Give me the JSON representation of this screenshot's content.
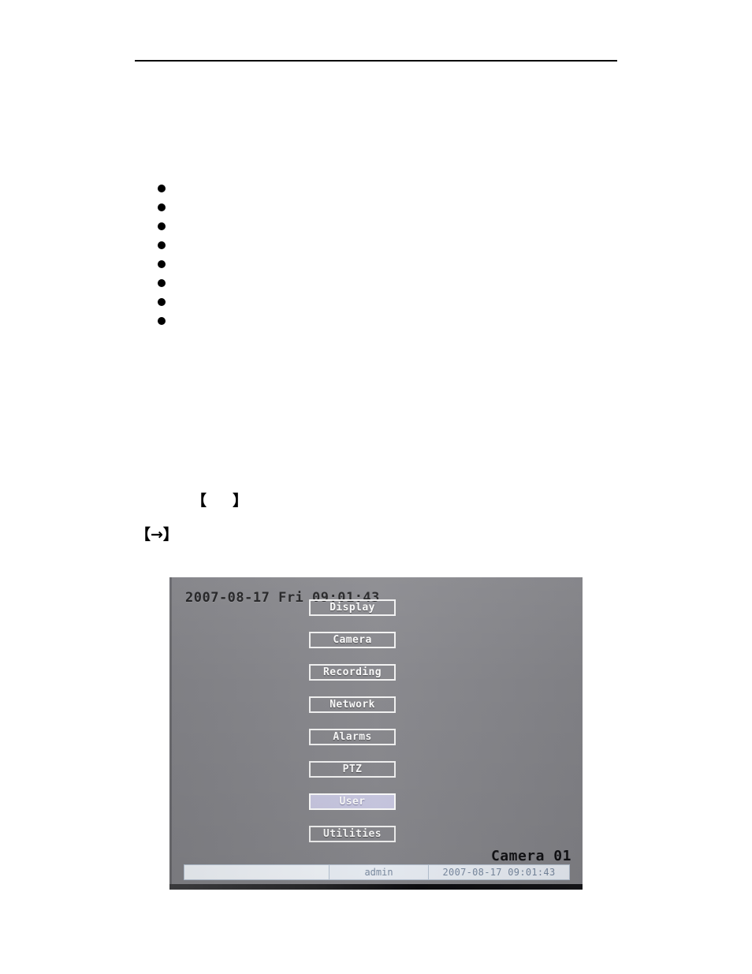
{
  "document": {
    "header_rule": true,
    "bullets": [
      {
        "text": ""
      },
      {
        "text": ""
      },
      {
        "text": ""
      },
      {
        "text": ""
      },
      {
        "text": ""
      },
      {
        "text": ""
      },
      {
        "text": ""
      },
      {
        "text": ""
      }
    ],
    "notes": [
      {
        "text": "【     】"
      },
      {
        "text": "【→】"
      }
    ]
  },
  "figure": {
    "osd": {
      "datetime": "2007-08-17 Fri 09:01:43",
      "camera_title": "Camera 01"
    },
    "menu": {
      "items": [
        {
          "label": "Display",
          "selected": false
        },
        {
          "label": "Camera",
          "selected": false
        },
        {
          "label": "Recording",
          "selected": false
        },
        {
          "label": "Network",
          "selected": false
        },
        {
          "label": "Alarms",
          "selected": false
        },
        {
          "label": "PTZ",
          "selected": false
        },
        {
          "label": "User",
          "selected": true
        },
        {
          "label": "Utilities",
          "selected": false
        }
      ]
    },
    "status_bar": {
      "message": "",
      "user": "admin",
      "datetime": "2007-08-17 09:01:43"
    },
    "colors": {
      "screen_background": "#86868b",
      "button_border": "#f2f2f2",
      "button_text": "#fbfbfb",
      "selected_fill": "#c9c8e2",
      "status_bar_fill": "#eef3fa",
      "status_bar_text": "#7b8ca3"
    }
  }
}
